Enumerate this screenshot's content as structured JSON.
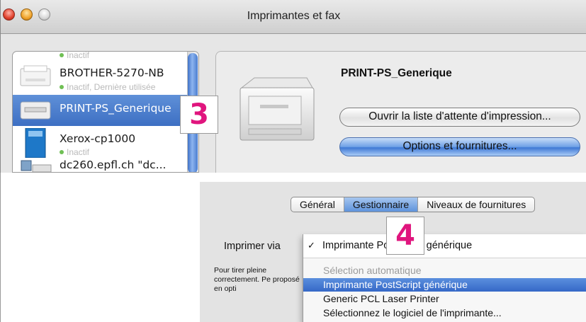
{
  "window": {
    "title": "Imprimantes et fax"
  },
  "printer_list": [
    {
      "name": "BROTHER-5270-NB",
      "status": "Inactif, Dernière utilisée",
      "icon": "printer-white-icon",
      "selected": false
    },
    {
      "name": "PRINT-PS_Generique",
      "status": "",
      "icon": "printer-generic-icon",
      "selected": true
    },
    {
      "name": "Xerox-cp1000",
      "status": "Inactif",
      "icon": "printer-blue-icon",
      "selected": false
    },
    {
      "name": "dc260.epfl.ch \"dc...",
      "status": "",
      "icon": "network-printer-icon",
      "selected": false
    }
  ],
  "list_top_partial": "Inactif",
  "step_markers": {
    "three": "3",
    "four": "4"
  },
  "detail": {
    "printer_name": "PRINT-PS_Generique",
    "queue_button": "Ouvrir la liste d'attente d'impression...",
    "options_button": "Options et fournitures..."
  },
  "tabs": [
    {
      "label": "Général",
      "active": false
    },
    {
      "label": "Gestionnaire",
      "active": true
    },
    {
      "label": "Niveaux de fournitures",
      "active": false
    }
  ],
  "driver": {
    "label": "Imprimer via",
    "paragraph": "Pour tirer pleine correctement. Pe proposé en opti",
    "current_value": "Imprimante PostScript générique",
    "options": [
      {
        "label": "Sélection automatique",
        "disabled": true
      },
      {
        "label": "Imprimante PostScript générique",
        "highlighted": true
      },
      {
        "label": "Generic PCL Laser Printer"
      },
      {
        "label": "Sélectionnez le logiciel de l'imprimante..."
      }
    ]
  },
  "colors": {
    "accent": "#3d6fc3",
    "step_marker": "#e0157e",
    "highlight": "#3568c7"
  }
}
